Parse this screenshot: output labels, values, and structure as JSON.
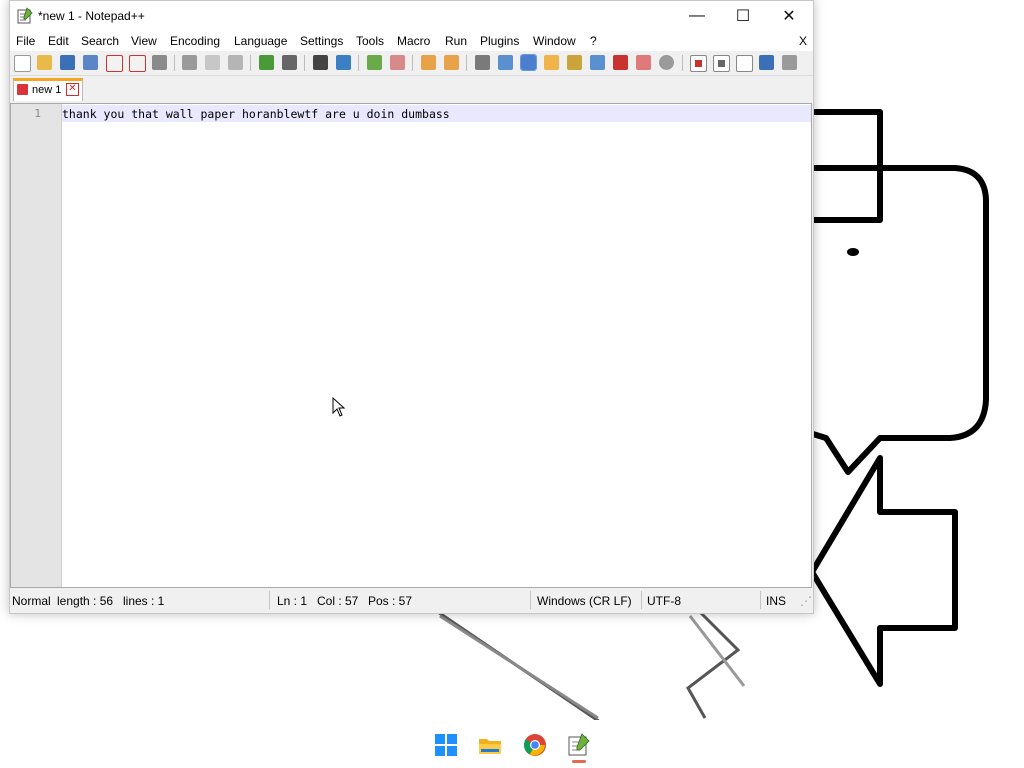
{
  "window": {
    "title": "*new 1 - Notepad++",
    "controls": {
      "minimize": "—",
      "maximize": "☐",
      "close": "✕"
    }
  },
  "menu": {
    "items": [
      "File",
      "Edit",
      "Search",
      "View",
      "Encoding",
      "Language",
      "Settings",
      "Tools",
      "Macro",
      "Run",
      "Plugins",
      "Window",
      "?"
    ],
    "close_label": "X"
  },
  "tab": {
    "label": "new 1",
    "close_glyph": "✕"
  },
  "editor": {
    "line_number": "1",
    "text": "thank you that wall paper horanblewtf are u doin dumbass"
  },
  "status": {
    "mode": "Normal",
    "length": "length : 56",
    "lines": "lines : 1",
    "ln": "Ln : 1",
    "col": "Col : 57",
    "pos": "Pos : 57",
    "eol": "Windows (CR LF)",
    "encoding": "UTF-8",
    "ins": "INS"
  },
  "taskbar": {
    "icons": [
      "windows-start-icon",
      "file-explorer-icon",
      "chrome-icon",
      "notepad-plus-plus-icon"
    ]
  },
  "colors": {
    "tab_accent": "#f5a623",
    "current_line": "#e8e8ff",
    "gutter": "#e4e4e4"
  }
}
